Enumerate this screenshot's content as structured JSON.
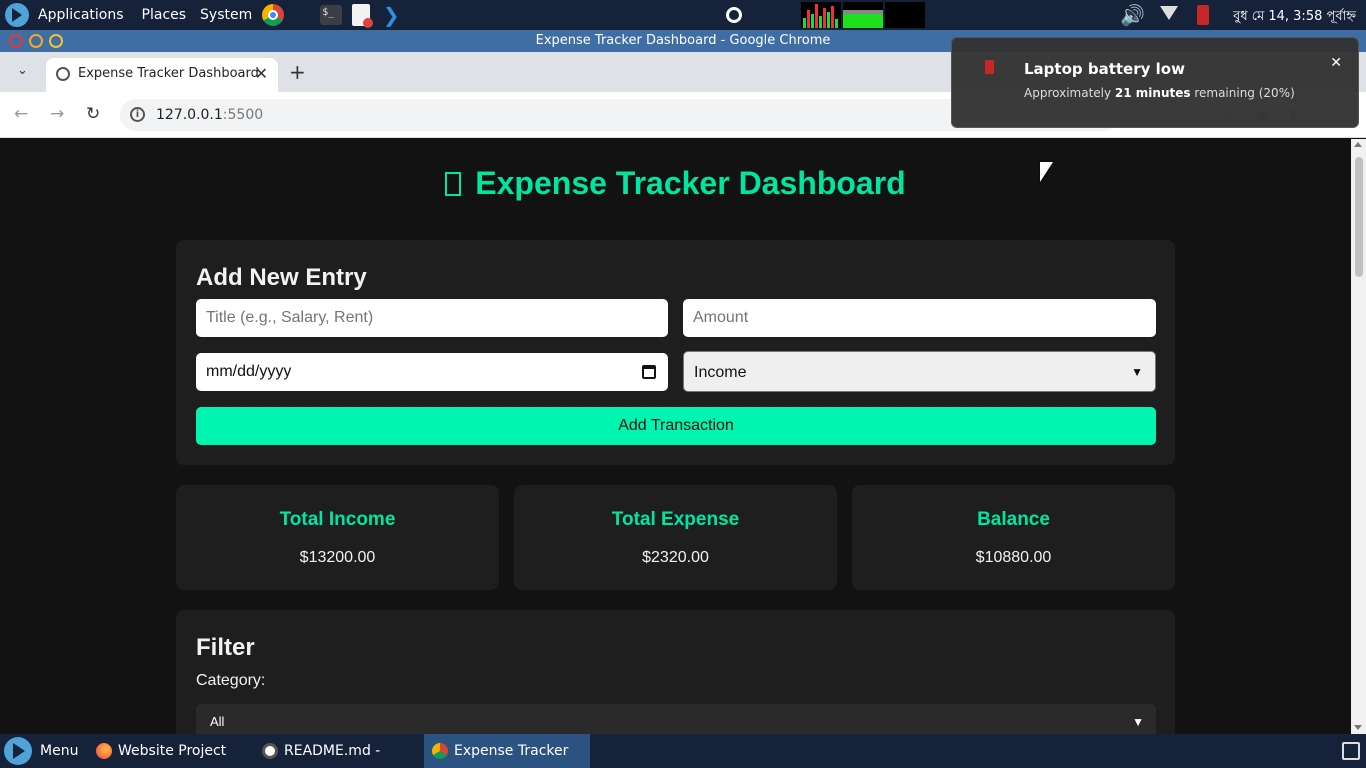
{
  "top_panel": {
    "menus": [
      "Applications",
      "Places",
      "System"
    ],
    "clock": "বুধ মে 14,  3:58 পূর্বাহ্ন"
  },
  "window": {
    "title": "Expense Tracker Dashboard - Google Chrome"
  },
  "tab": {
    "title": "Expense Tracker Dashboard",
    "close": "✕",
    "new_tab": "+"
  },
  "address_bar": {
    "host": "127.0.0.1",
    "port": ":5500"
  },
  "notification": {
    "title": "Laptop battery low",
    "body_prefix": "Approximately ",
    "body_bold": "21 minutes",
    "body_suffix": " remaining (20%)",
    "close": "✕"
  },
  "page": {
    "title": "Expense Tracker Dashboard",
    "entry": {
      "heading": "Add New Entry",
      "title_placeholder": "Title (e.g., Salary, Rent)",
      "amount_placeholder": "Amount",
      "date_placeholder": "mm/dd/yyyy",
      "type_selected": "Income",
      "submit_label": "Add Transaction"
    },
    "stats": {
      "income_label": "Total Income",
      "income_value": "$13200.00",
      "expense_label": "Total Expense",
      "expense_value": "$2320.00",
      "balance_label": "Balance",
      "balance_value": "$10880.00"
    },
    "filter": {
      "heading": "Filter",
      "category_label": "Category:",
      "category_selected": "All"
    }
  },
  "taskbar": {
    "menu_label": "Menu",
    "items": [
      "Website Project Ide...",
      "README.md - Totor...",
      "Expense Tracker Da..."
    ]
  },
  "colors": {
    "accent": "#00e6a0",
    "button": "#00f5b0",
    "page_bg": "#121212",
    "card_bg": "#1e1e1e",
    "panel_bg": "#15223a"
  }
}
